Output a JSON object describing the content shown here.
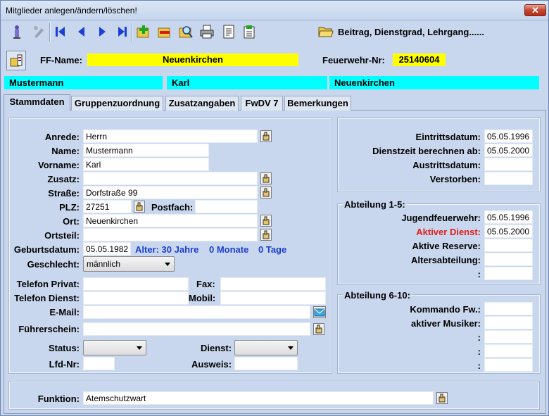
{
  "window": {
    "title": "Mitglieder anlegen/ändern/löschen!",
    "close": "✕"
  },
  "toolbar": {
    "caption": "Beitrag, Dienstgrad, Lehrgang......",
    "icons": [
      "user-pin-icon",
      "edit-disabled-icon",
      "first-record-icon",
      "prev-record-icon",
      "next-record-icon",
      "last-record-icon",
      "new-folder-icon",
      "delete-folder-icon",
      "search-folder-icon",
      "print-icon",
      "report-icon",
      "export-icon",
      "open-folder-icon"
    ]
  },
  "header": {
    "ff_label": "FF-Name:",
    "ff_value": "Neuenkirchen",
    "fw_label": "Feuerwehr-Nr:",
    "fw_value": "25140604",
    "colors": {
      "yellow": "#ffff00",
      "cyan": "#00ffff"
    }
  },
  "namebar": {
    "lastname": "Mustermann",
    "firstname": "Karl",
    "town": "Neuenkirchen"
  },
  "tabs": [
    "Stammdaten",
    "Gruppenzuordnung",
    "Zusatzangaben",
    "FwDV 7",
    "Bemerkungen"
  ],
  "form": {
    "anrede": {
      "label": "Anrede:",
      "value": "Herrn"
    },
    "name": {
      "label": "Name:",
      "value": "Mustermann"
    },
    "vorname": {
      "label": "Vorname:",
      "value": "Karl"
    },
    "zusatz": {
      "label": "Zusatz:",
      "value": ""
    },
    "strasse": {
      "label": "Straße:",
      "value": "Dorfstraße 99"
    },
    "plz": {
      "label": "PLZ:",
      "value": "27251"
    },
    "postfach": {
      "label": "Postfach:",
      "value": ""
    },
    "ort": {
      "label": "Ort:",
      "value": "Neuenkirchen"
    },
    "ortsteil": {
      "label": "Ortsteil:",
      "value": ""
    },
    "geburt": {
      "label": "Geburtsdatum:",
      "value": "05.05.1982"
    },
    "alter": {
      "years": "Alter: 30 Jahre",
      "months": "0 Monate",
      "days": "0 Tage"
    },
    "geschlecht": {
      "label": "Geschlecht:",
      "value": "männlich"
    },
    "tel_privat": {
      "label": "Telefon Privat:",
      "value": ""
    },
    "fax": {
      "label": "Fax:",
      "value": ""
    },
    "tel_dienst": {
      "label": "Telefon Dienst:",
      "value": ""
    },
    "mobil": {
      "label": "Mobil:",
      "value": ""
    },
    "email": {
      "label": "E-Mail:",
      "value": ""
    },
    "fuehrerschein": {
      "label": "Führerschein:",
      "value": ""
    },
    "status": {
      "label": "Status:",
      "value": ""
    },
    "dienst": {
      "label": "Dienst:",
      "value": ""
    },
    "lfdnr": {
      "label": "Lfd-Nr:",
      "value": ""
    },
    "ausweis": {
      "label": "Ausweis:",
      "value": ""
    },
    "funktion": {
      "label": "Funktion:",
      "value": "Atemschutzwart"
    }
  },
  "dates": {
    "eintritt": {
      "label": "Eintrittsdatum:",
      "value": "05.05.1996"
    },
    "dienstzeit": {
      "label": "Dienstzeit berechnen ab:",
      "value": "05.05.2000"
    },
    "austritt": {
      "label": "Austrittsdatum:",
      "value": ""
    },
    "verstorben": {
      "label": "Verstorben:",
      "value": ""
    }
  },
  "abt15": {
    "title": "Abteilung 1-5:",
    "jugend": {
      "label": "Jugendfeuerwehr:",
      "value": "05.05.1996"
    },
    "aktiv": {
      "label": "Aktiver Dienst:",
      "value": "05.05.2000",
      "color": "#e0201c"
    },
    "reserve": {
      "label": "Aktive Reserve:",
      "value": ""
    },
    "alters": {
      "label": "Altersabteilung:",
      "value": ""
    },
    "extra": {
      "label": ":",
      "value": ""
    }
  },
  "abt610": {
    "title": "Abteilung 6-10:",
    "kommando": {
      "label": "Kommando Fw.:",
      "value": ""
    },
    "musiker": {
      "label": "aktiver Musiker:",
      "value": ""
    },
    "e1": {
      "label": ":",
      "value": ""
    },
    "e2": {
      "label": ":",
      "value": ""
    },
    "e3": {
      "label": ":",
      "value": ""
    }
  }
}
